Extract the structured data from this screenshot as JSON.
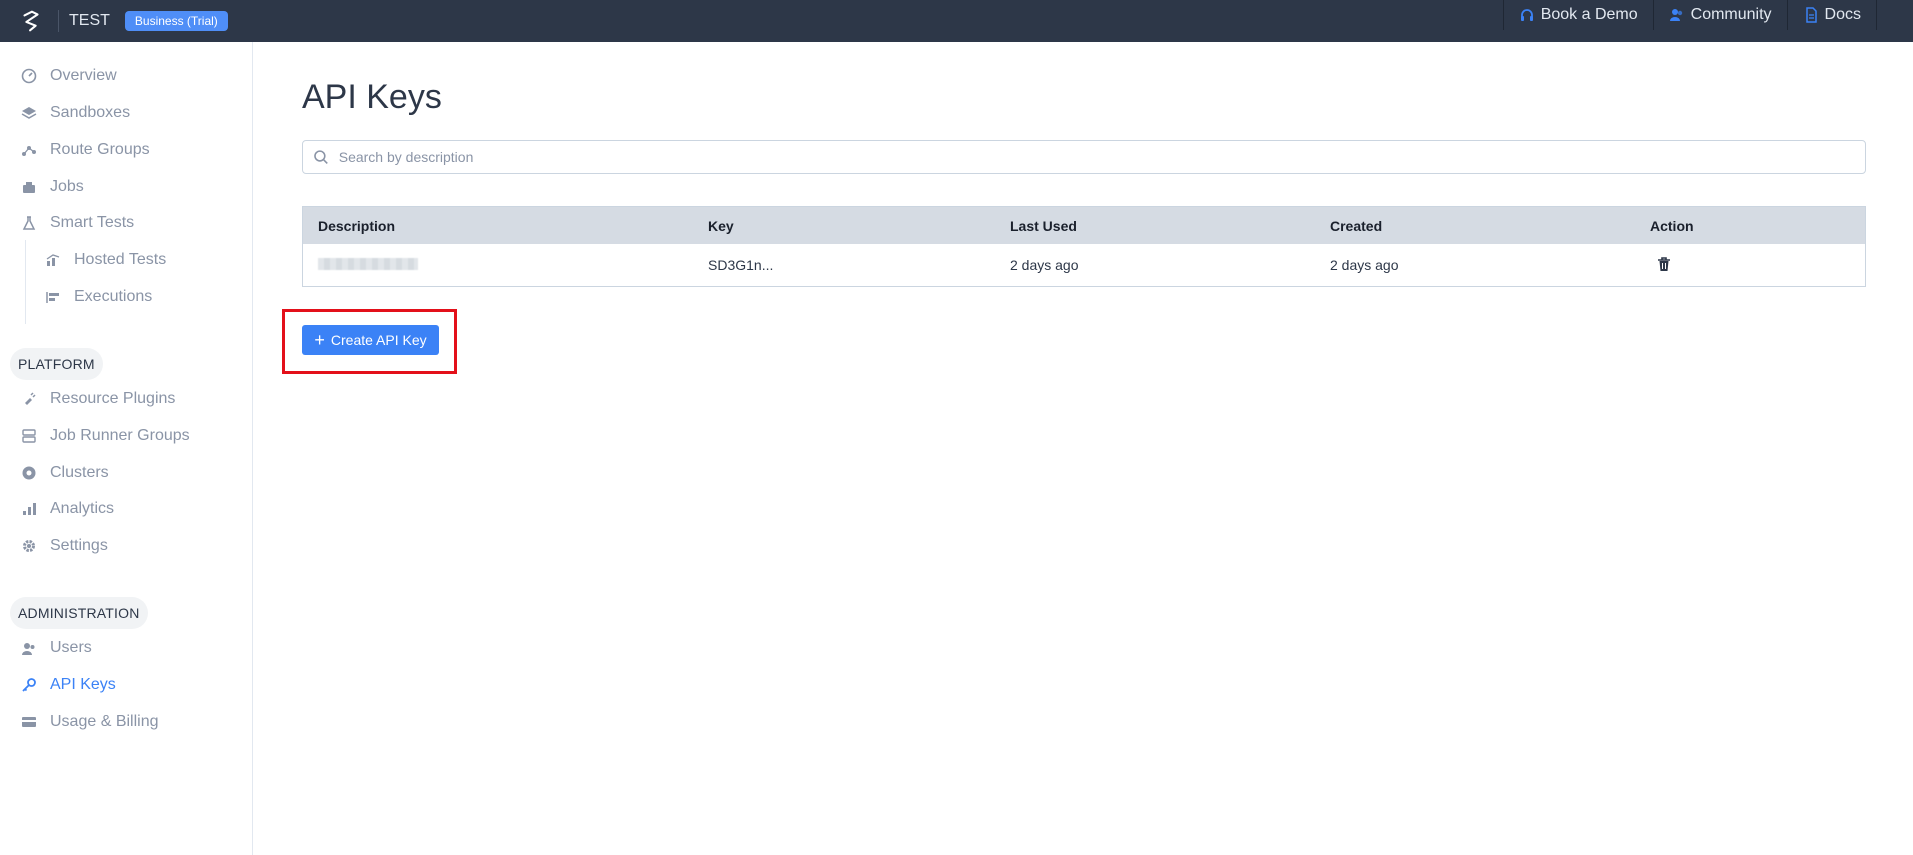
{
  "header": {
    "org_name": "TEST",
    "plan_badge": "Business (Trial)",
    "nav": [
      {
        "label": "Book a Demo",
        "icon": "headset-icon"
      },
      {
        "label": "Community",
        "icon": "users-icon"
      },
      {
        "label": "Docs",
        "icon": "document-icon"
      }
    ]
  },
  "sidebar": {
    "items": [
      {
        "label": "Overview",
        "icon": "gauge-icon"
      },
      {
        "label": "Sandboxes",
        "icon": "layers-icon"
      },
      {
        "label": "Route Groups",
        "icon": "route-icon"
      },
      {
        "label": "Jobs",
        "icon": "jobs-icon"
      },
      {
        "label": "Smart Tests",
        "icon": "flask-icon"
      },
      {
        "label": "Hosted Tests",
        "icon": "chart-icon"
      },
      {
        "label": "Executions",
        "icon": "executions-icon"
      }
    ],
    "platform_label": "PLATFORM",
    "platform_items": [
      {
        "label": "Resource Plugins",
        "icon": "plug-icon"
      },
      {
        "label": "Job Runner Groups",
        "icon": "server-icon"
      },
      {
        "label": "Clusters",
        "icon": "cluster-icon"
      },
      {
        "label": "Analytics",
        "icon": "bar-chart-icon"
      },
      {
        "label": "Settings",
        "icon": "gear-icon"
      }
    ],
    "admin_label": "ADMINISTRATION",
    "admin_items": [
      {
        "label": "Users",
        "icon": "users-icon"
      },
      {
        "label": "API Keys",
        "icon": "key-icon",
        "active": true
      },
      {
        "label": "Usage & Billing",
        "icon": "credit-card-icon"
      }
    ]
  },
  "main": {
    "title": "API Keys",
    "search_placeholder": "Search by description",
    "table": {
      "columns": [
        "Description",
        "Key",
        "Last Used",
        "Created",
        "Action"
      ],
      "rows": [
        {
          "key": "SD3G1n...",
          "last_used": "2 days ago",
          "created": "2 days ago"
        }
      ]
    },
    "create_button": "Create API Key"
  },
  "colors": {
    "topbar": "#2d3748",
    "accent": "#3b82f6",
    "highlight_box": "#e3101a"
  }
}
